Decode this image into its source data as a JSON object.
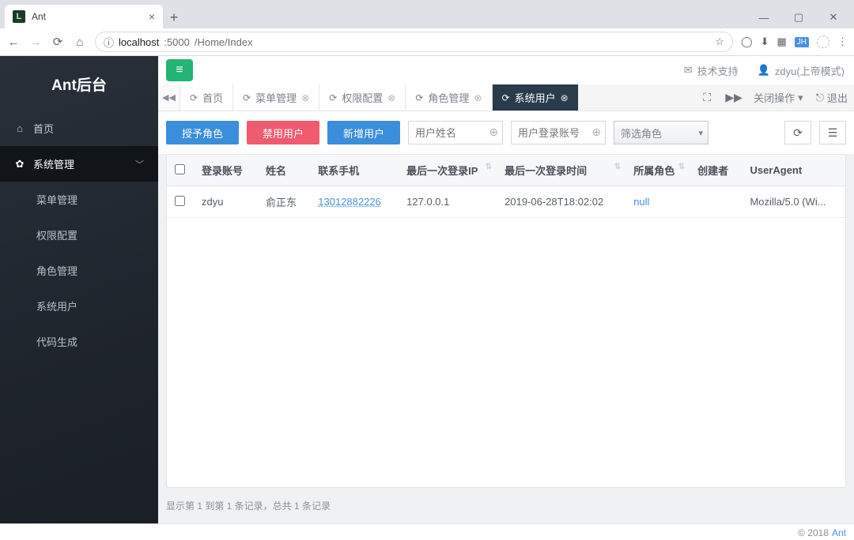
{
  "browser": {
    "tab_title": "Ant",
    "url_host": "localhost",
    "url_port": ":5000",
    "url_path": "/Home/Index"
  },
  "sidebar": {
    "logo": "Ant后台",
    "home": "首页",
    "section": "系统管理",
    "items": [
      "菜单管理",
      "权限配置",
      "角色管理",
      "系统用户",
      "代码生成"
    ]
  },
  "topbar": {
    "support": "技术支持",
    "user": "zdyu(上帝模式)"
  },
  "tabs": {
    "items": [
      "首页",
      "菜单管理",
      "权限配置",
      "角色管理",
      "系统用户"
    ],
    "active_index": 4,
    "close_ops": "关闭操作",
    "logout": "退出"
  },
  "toolbar": {
    "grant_role": "授予角色",
    "disable_user": "禁用用户",
    "add_user": "新增用户",
    "ph_name": "用户姓名",
    "ph_account": "用户登录账号",
    "filter_role": "筛选角色"
  },
  "table": {
    "headers": [
      "登录账号",
      "姓名",
      "联系手机",
      "最后一次登录IP",
      "最后一次登录时间",
      "所属角色",
      "创建者",
      "UserAgent"
    ],
    "row": {
      "account": "zdyu",
      "name": "俞正东",
      "phone": "13012882226",
      "ip": "127.0.0.1",
      "last_login": "2019-06-28T18:02:02",
      "role": "null",
      "creator": "",
      "ua": "Mozilla/5.0 (Wi..."
    }
  },
  "pager": "显示第 1 到第 1 条记录，总共 1 条记录",
  "footer": {
    "copy": "© 2018",
    "link": "Ant"
  }
}
